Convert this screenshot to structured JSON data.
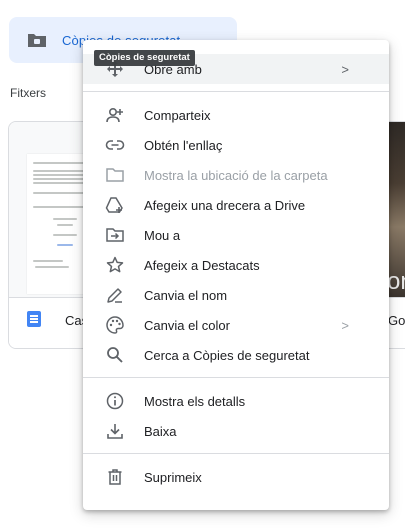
{
  "folder_chip": {
    "label": "Còpies de seguretat"
  },
  "section": {
    "label": "Fitxers"
  },
  "files": [
    {
      "name": "Cas"
    },
    {
      "name": "Goo"
    }
  ],
  "photo_text": "on",
  "tooltip": {
    "text": "Còpies de seguretat"
  },
  "menu": {
    "open_with": {
      "label": "Obre amb",
      "arrow": ">"
    },
    "share": {
      "label": "Comparteix"
    },
    "get_link": {
      "label": "Obtén l'enllaç"
    },
    "show_folder": {
      "label": "Mostra la ubicació de la carpeta"
    },
    "add_shortcut": {
      "label": "Afegeix una drecera a Drive"
    },
    "move_to": {
      "label": "Mou a"
    },
    "add_starred": {
      "label": "Afegeix a Destacats"
    },
    "rename": {
      "label": "Canvia el nom"
    },
    "change_color": {
      "label": "Canvia el color",
      "arrow": ">"
    },
    "search_in": {
      "label": "Cerca a Còpies de seguretat"
    },
    "details": {
      "label": "Mostra els detalls"
    },
    "download": {
      "label": "Baixa"
    },
    "remove": {
      "label": "Suprimeix"
    }
  },
  "colors": {
    "accent": "#1967d2",
    "chip_bg": "#e8f0fe",
    "hover_bg": "#f1f3f4",
    "icon": "#5f6368",
    "disabled": "#9aa0a6"
  }
}
